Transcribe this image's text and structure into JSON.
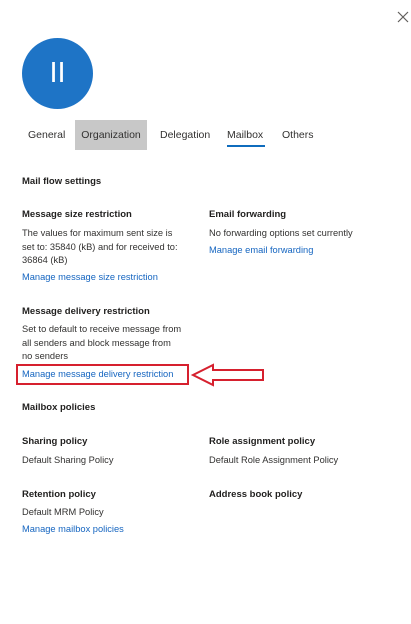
{
  "avatar": {
    "initials": "II",
    "color": "#1e74c6"
  },
  "tabs": [
    {
      "label": "General"
    },
    {
      "label": "Organization"
    },
    {
      "label": "Delegation"
    },
    {
      "label": "Mailbox"
    },
    {
      "label": "Others"
    }
  ],
  "mail_flow": {
    "title": "Mail flow settings",
    "size": {
      "heading": "Message size restriction",
      "lines": [
        "The values for maximum sent size is",
        "set to: 35840 (kB) and for received to:",
        "36864 (kB)"
      ],
      "link": "Manage message size restriction"
    },
    "forwarding": {
      "heading": "Email forwarding",
      "text": "No forwarding options set currently",
      "link": "Manage email forwarding"
    },
    "delivery": {
      "heading": "Message delivery restriction",
      "lines": [
        "Set to default to receive message from",
        "all senders and block message from",
        "no senders"
      ],
      "link": "Manage message delivery restriction"
    }
  },
  "policies": {
    "title": "Mailbox policies",
    "sharing": {
      "heading": "Sharing policy",
      "value": "Default Sharing Policy"
    },
    "role": {
      "heading": "Role assignment policy",
      "value": "Default Role Assignment Policy"
    },
    "retention": {
      "heading": "Retention policy",
      "value": "Default MRM Policy",
      "link": "Manage mailbox policies"
    },
    "address_book": {
      "heading": "Address book policy"
    }
  },
  "colors": {
    "accent": "#0f6cbd",
    "link": "#1565c0",
    "highlight": "#d6202e",
    "tab_hover": "#c8c8c8"
  }
}
